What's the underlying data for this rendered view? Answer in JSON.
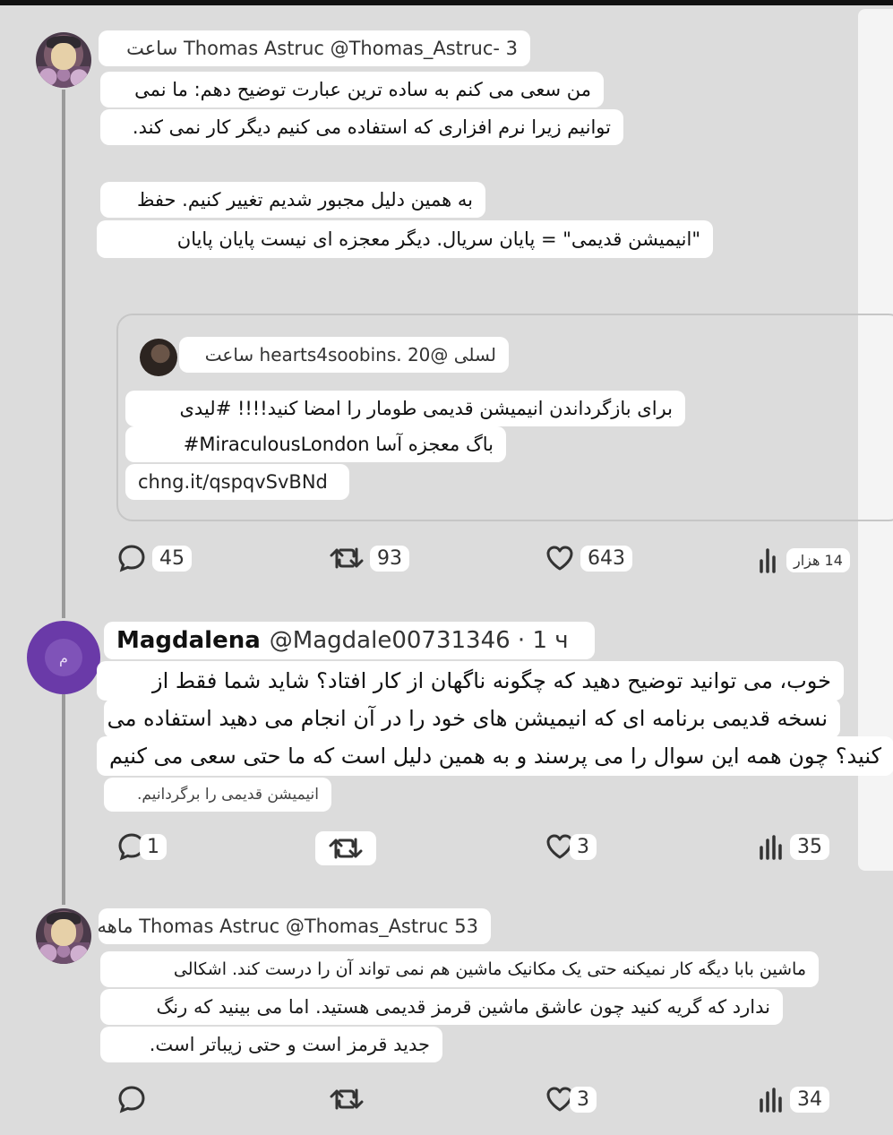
{
  "posts": [
    {
      "header": "Thomas Astruc @Thomas_Astruc- 3 ساعت",
      "body_lines": [
        "من سعی می کنم به ساده ترین عبارت توضیح دهم: ما نمی",
        "توانیم زیرا نرم افزاری که استفاده می کنیم دیگر کار نمی کند.",
        "به همین دلیل مجبور شدیم تغییر کنیم. حفظ",
        "\"انیمیشن قدیمی\" = پایان سریال. دیگر معجزه ای نیست پایان پایان"
      ],
      "quote": {
        "header": "لسلی @hearts4soobins. 20 ساعت",
        "body_lines": [
          "برای بازگرداندن انیمیشن قدیمی طومار را امضا کنید!!!! #لیدی",
          "باگ معجزه آسا MiraculousLondon#",
          "chng.it/qspqvSvBNd"
        ]
      },
      "actions": {
        "replies": "45",
        "reposts": "93",
        "likes": "643",
        "views": "14 هزار"
      }
    },
    {
      "name": "Magdalena",
      "handle_time": "@Magdale00731346 · 1 ч",
      "avatar_letter": "م",
      "body_lines": [
        "خوب، می توانید توضیح دهید که چگونه ناگهان از کار افتاد؟ شاید شما فقط از",
        "نسخه قدیمی برنامه ای که انیمیشن های خود را در آن انجام می دهید استفاده می",
        "کنید؟ چون همه این سوال را می پرسند و به همین دلیل است که ما حتی سعی می کنیم",
        "انیمیشن قدیمی را برگردانیم."
      ],
      "actions": {
        "replies": "1",
        "reposts": "",
        "likes": "3",
        "views": "35"
      }
    },
    {
      "header": "Thomas Astruc @Thomas_Astruc 53 ماهه",
      "body_lines": [
        "ماشین بابا دیگه کار نمیکنه حتی یک مکانیک ماشین هم نمی تواند آن را درست کند. اشکالی",
        "ندارد که گریه کنید چون عاشق ماشین قرمز قدیمی هستید. اما می بینید که رنگ",
        "جدید قرمز است و حتی زیباتر است."
      ],
      "actions": {
        "replies": "",
        "reposts": "",
        "likes": "3",
        "views": "34"
      }
    }
  ],
  "icons": {
    "reply": "reply-icon",
    "repost": "repost-icon",
    "like": "heart-icon",
    "views": "views-chart-icon"
  }
}
